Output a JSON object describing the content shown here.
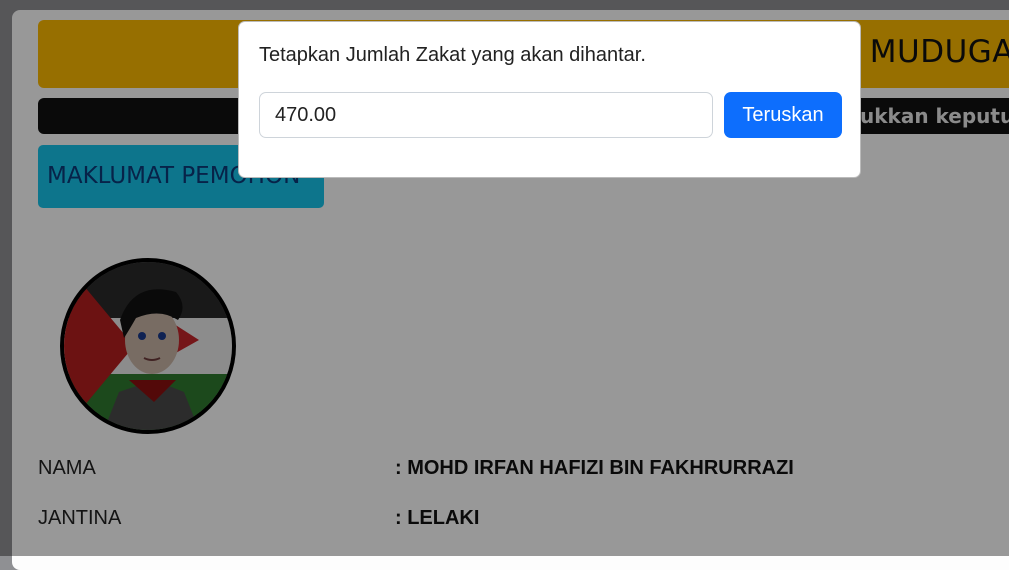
{
  "header": {
    "title_fragment": "MUDUGA",
    "marquee_fragment": "ukkan keputus"
  },
  "section": {
    "button_label": "MAKLUMAT PEMOHON"
  },
  "applicant": {
    "fields": [
      {
        "label": "NAMA",
        "value": ": MOHD IRFAN HAFIZI BIN FAKHRURRAZI"
      },
      {
        "label": "JANTINA",
        "value": ": LELAKI"
      }
    ]
  },
  "modal": {
    "message": "Tetapkan Jumlah Zakat yang akan dihantar.",
    "amount_value": "470.00",
    "continue_label": "Teruskan"
  },
  "colors": {
    "yellow_banner": "#fcb900",
    "dark_banner": "#121212",
    "section_button": "#17c4e9",
    "primary_button": "#0d6efd"
  }
}
